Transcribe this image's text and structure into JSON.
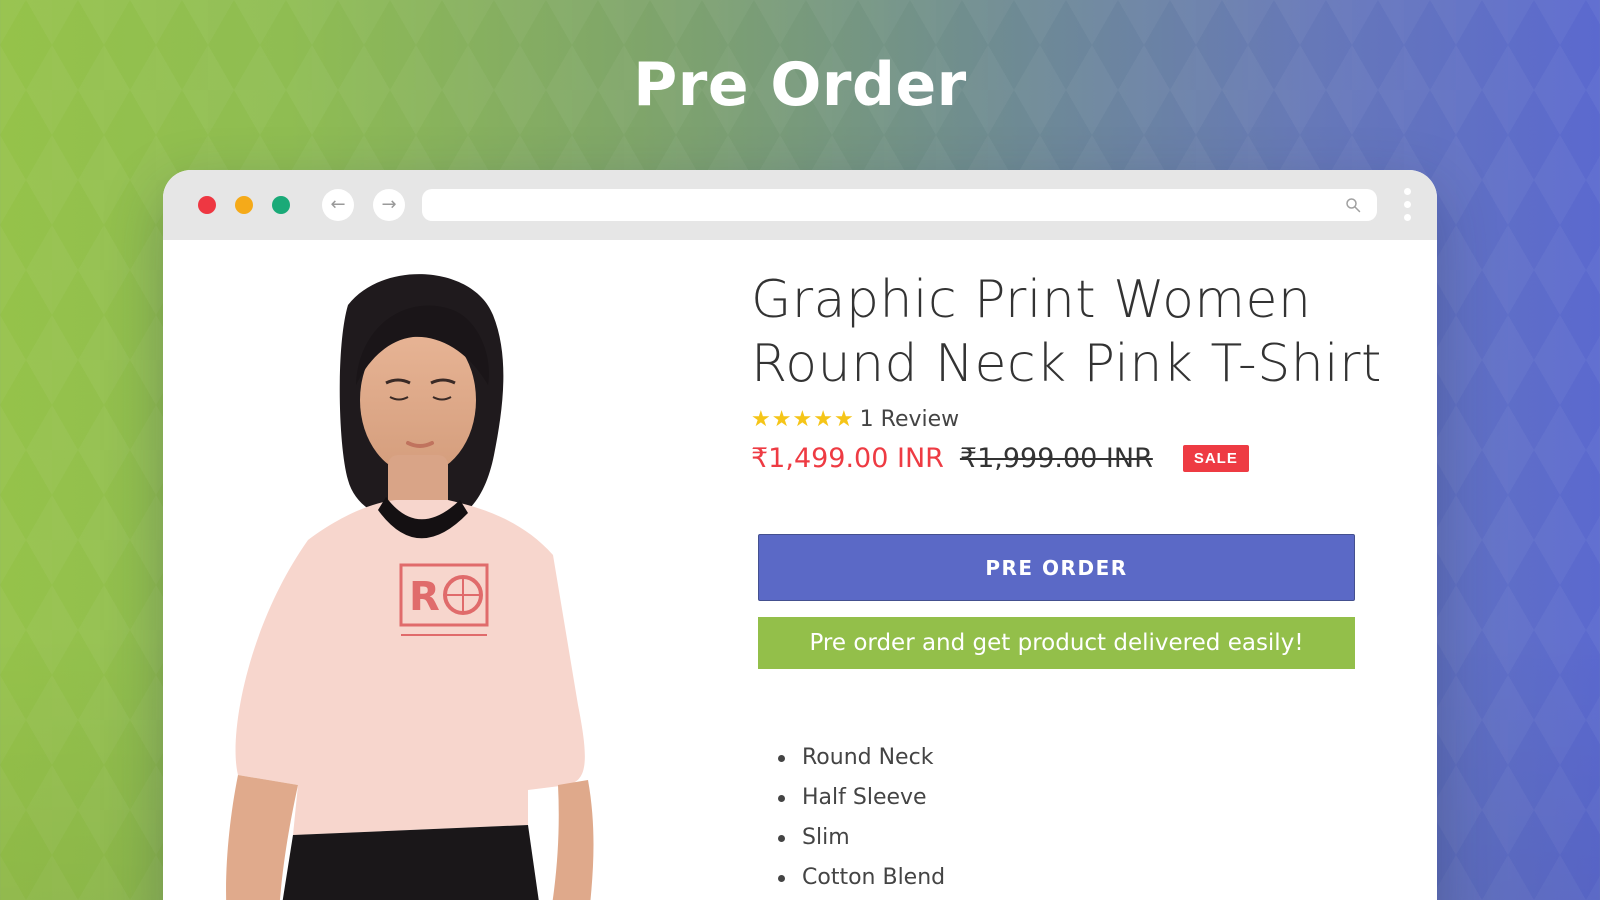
{
  "hero": {
    "title": "Pre Order"
  },
  "browser": {
    "traffic_lights": [
      "#ee3742",
      "#f5aa19",
      "#1aaa78"
    ],
    "back_icon": "arrow-left-icon",
    "forward_icon": "arrow-right-icon",
    "search_icon": "search-icon",
    "menu_icon": "more-vertical-icon"
  },
  "product": {
    "title": "Graphic Print Women Round Neck Pink T-Shirt",
    "rating": 5,
    "reviews_label": "1 Review",
    "price_sale": "₹1,499.00 INR",
    "price_regular": "₹1,999.00 INR",
    "badge": "SALE",
    "preorder_label": "PRE ORDER",
    "promo_text": "Pre order and get product delivered easily!",
    "features": [
      "Round Neck",
      "Half Sleeve",
      "Slim",
      "Cotton Blend"
    ]
  },
  "colors": {
    "accent_blue": "#5b69c6",
    "accent_green": "#93bf4a",
    "sale_red": "#ee3b43",
    "star_yellow": "#f5c518"
  }
}
